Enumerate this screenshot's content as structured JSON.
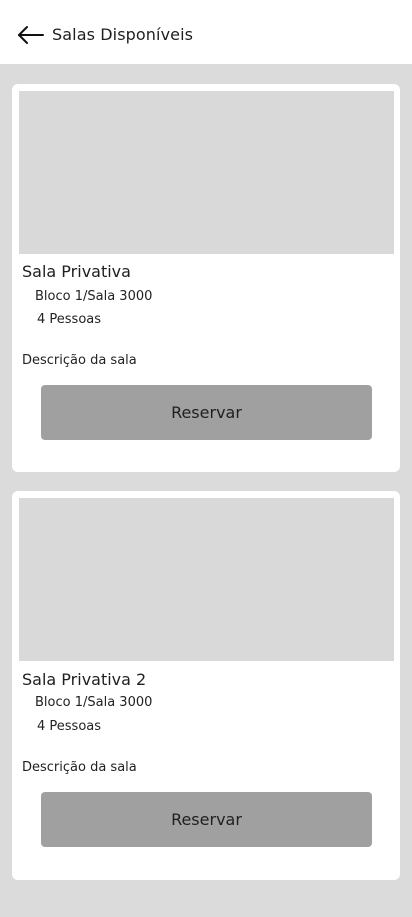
{
  "header": {
    "title": "Salas Disponíveis",
    "back_icon": "arrow-left-icon"
  },
  "rooms": [
    {
      "name": "Sala Privativa",
      "location": "Bloco 1/Sala 3000",
      "capacity": "4 Pessoas",
      "description": "Descrição da sala",
      "button_label": "Reservar"
    },
    {
      "name": "Sala Privativa 2",
      "location": "Bloco 1/Sala 3000",
      "capacity": "4 Pessoas",
      "description": "Descrição da sala",
      "button_label": "Reservar"
    }
  ],
  "colors": {
    "background": "#dbdbdb",
    "card": "#ffffff",
    "image_placeholder": "#d9d9d9",
    "button": "#a0a0a0"
  }
}
